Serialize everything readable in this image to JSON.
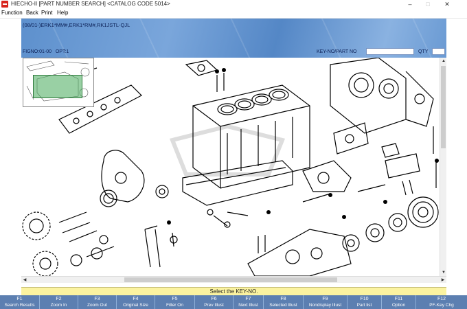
{
  "window": {
    "title": "HIECHO-II [PART NUMBER SEARCH] <CATALOG CODE 5014>",
    "controls": [
      "–",
      "□",
      "✕"
    ]
  },
  "menu": [
    "Function",
    "Back",
    "Print",
    "Help"
  ],
  "header": {
    "model": "(08/01-)ERK1*MM#,ERK1*RM#,RK1JSTL-QJL",
    "figno": "FIGNO:01-00",
    "opt": "OPT:1",
    "keyno_label": "KEY-NO/PART NO",
    "keyno_value": "",
    "qty_label": "QTY"
  },
  "status": "Select the KEY-NO.",
  "fkeys": [
    {
      "key": "F1",
      "label": "Search Results"
    },
    {
      "key": "F2",
      "label": "Zoom In"
    },
    {
      "key": "F3",
      "label": "Zoom Out"
    },
    {
      "key": "F4",
      "label": "Original Size"
    },
    {
      "key": "F5",
      "label": "Filter On"
    },
    {
      "key": "F6",
      "label": "Prev Illust"
    },
    {
      "key": "F7",
      "label": "Next Illust"
    },
    {
      "key": "F8",
      "label": "Selected Illust"
    },
    {
      "key": "F9",
      "label": "Nondisplay Illust"
    },
    {
      "key": "F10",
      "label": "Part list"
    },
    {
      "key": "F11",
      "label": "Option"
    },
    {
      "key": "F12",
      "label": "PF-Key Chg"
    }
  ],
  "colors": {
    "banner": "#6a9ad3",
    "status_bg": "#fbf3a0",
    "fkey_bg": "#5c7fb1",
    "thumb_highlight": "#46aa5a"
  }
}
